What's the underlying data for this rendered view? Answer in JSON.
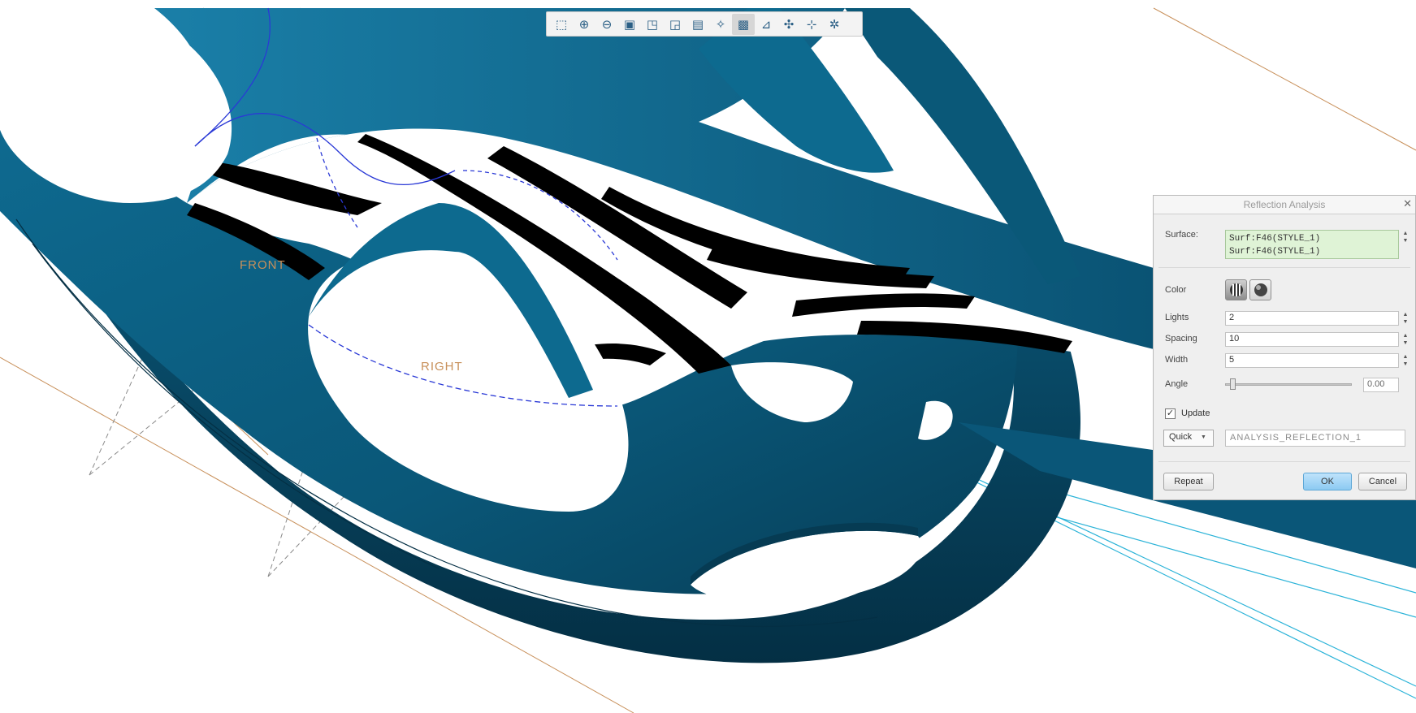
{
  "datum_labels": {
    "front": "FRONT",
    "right": "RIGHT"
  },
  "view_toolbar": {
    "buttons": [
      {
        "icon": "refit-icon",
        "glyph": "⬚"
      },
      {
        "icon": "zoom-in-icon",
        "glyph": "⊕"
      },
      {
        "icon": "zoom-out-icon",
        "glyph": "⊖"
      },
      {
        "icon": "repaint-icon",
        "glyph": "▣"
      },
      {
        "icon": "view-manager-icon",
        "glyph": "◳"
      },
      {
        "icon": "saved-views-icon",
        "glyph": "◲"
      },
      {
        "icon": "display-style-icon",
        "glyph": "▤"
      },
      {
        "icon": "datum-display-icon",
        "glyph": "✧"
      },
      {
        "icon": "annotation-display-icon",
        "glyph": "▩"
      },
      {
        "icon": "axis-display-icon",
        "glyph": "⊿"
      },
      {
        "icon": "point-display-icon",
        "glyph": "✣"
      },
      {
        "icon": "csys-display-icon",
        "glyph": "⊹"
      },
      {
        "icon": "spin-center-icon",
        "glyph": "✲"
      }
    ]
  },
  "dialog": {
    "title": "Reflection Analysis",
    "close_glyph": "✕",
    "surface_label": "Surface:",
    "surface_items": [
      "Surf:F46(STYLE_1)",
      "Surf:F46(STYLE_1)"
    ],
    "color_label": "Color",
    "lights_label": "Lights",
    "lights_value": "2",
    "spacing_label": "Spacing",
    "spacing_value": "10",
    "width_label": "Width",
    "width_value": "5",
    "angle_label": "Angle",
    "angle_value": "0.00",
    "angle_slider_fraction": 0.0,
    "update_label": "Update",
    "update_checked": true,
    "type_value": "Quick",
    "name_value": "ANALYSIS_REFLECTION_1",
    "repeat_label": "Repeat",
    "ok_label": "OK",
    "cancel_label": "Cancel"
  },
  "colors": {
    "part": "#0b5a7c",
    "part_dark": "#063f59",
    "part_light": "#1b7aa0",
    "datum_plane": "#c8905a",
    "curve_blue": "#2a39d6",
    "cyan_line": "#2bb3d8"
  }
}
